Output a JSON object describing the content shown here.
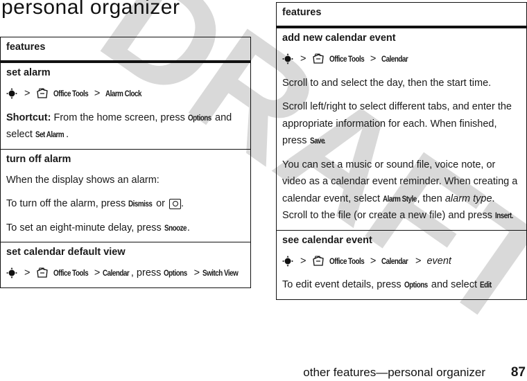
{
  "page": {
    "title": "personal organizer",
    "footer_text": "other features—personal organizer",
    "page_number": "87",
    "watermark": "DRAFT",
    "watermark_color": "#d9d9d9"
  },
  "left_table": {
    "header": "features",
    "rows": [
      {
        "title": "set alarm",
        "path": [
          "Office Tools",
          "Alarm Clock"
        ],
        "shortcut_label": "Shortcut:",
        "shortcut_text_1": " From the home screen, press ",
        "shortcut_cmd_1": "Options",
        "shortcut_text_2": " and select ",
        "shortcut_cmd_2": "Set Alarm",
        "shortcut_text_3": "."
      },
      {
        "title": "turn off alarm",
        "line1": "When the display shows an alarm:",
        "line2_text": "To turn off the alarm, press ",
        "line2_cmd": "Dismiss",
        "line2_or": " or ",
        "line2_end": ".",
        "line3_text": "To set an eight-minute delay, press ",
        "line3_cmd": "Snooze",
        "line3_end": "."
      },
      {
        "title": "set calendar default view",
        "path_1": "Office Tools",
        "path_2": "Calendar",
        "press_text": ", press ",
        "cmd_options": "Options",
        "cmd_switch": "Switch View"
      }
    ]
  },
  "right_table": {
    "header": "features",
    "rows": [
      {
        "title": "add new calendar event",
        "path": [
          "Office Tools",
          "Calendar"
        ],
        "para1": "Scroll to and select the day, then the start time.",
        "para2_text": "Scroll left/right to select different tabs, and enter the appropriate information for each. When finished, press ",
        "para2_cmd": "Save",
        "para2_end": ".",
        "para3_text_1": "You can set a music or sound file, voice note, or video as a calendar event reminder. When creating a calendar event, select ",
        "para3_cmd_1": "Alarm Style",
        "para3_text_2": ", then ",
        "para3_italic": "alarm type",
        "para3_text_3": ". Scroll to the file (or create a new file) and press ",
        "para3_cmd_2": "Insert",
        "para3_end": "."
      },
      {
        "title": "see calendar event",
        "path": [
          "Office Tools",
          "Calendar"
        ],
        "path_italic": "event",
        "para_text_1": "To edit event details, press ",
        "para_cmd_1": "Options",
        "para_text_2": " and select ",
        "para_cmd_2": "Edit",
        "para_end": "."
      }
    ]
  },
  "symbols": {
    "separator": ">",
    "nav_icon": "navigation-key-icon",
    "office_icon": "office-tools-icon",
    "key_icon": "power-end-key-icon"
  }
}
